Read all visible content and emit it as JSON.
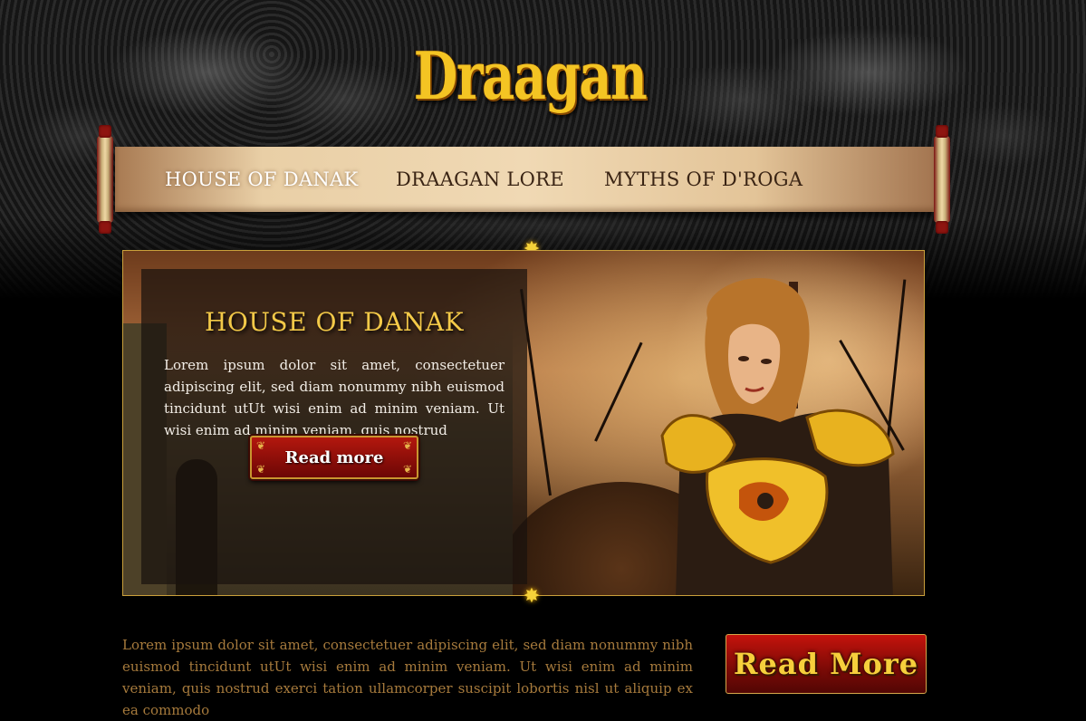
{
  "brand": {
    "logo_text": "Draagan"
  },
  "nav": {
    "items": [
      {
        "label": "HOUSE OF DANAK",
        "active": true
      },
      {
        "label": "DRAAGAN LORE",
        "active": false
      },
      {
        "label": "MYTHS OF D'ROGA",
        "active": false
      }
    ]
  },
  "hero": {
    "title": "HOUSE OF DANAK",
    "text": "Lorem ipsum dolor sit amet, consectetuer adipiscing elit, sed diam nonummy nibh euismod tincidunt utUt wisi enim ad minim veniam. Ut wisi enim ad minim veniam, quis nostrud",
    "button_label": "Read more"
  },
  "intro": {
    "text": "Lorem ipsum dolor sit amet, consectetuer adipiscing elit, sed diam nonummy nibh euismod tincidunt utUt wisi enim ad minim veniam. Ut wisi enim ad minim veniam, quis nostrud exerci tation ullamcorper suscipit lobortis nisl ut aliquip ex ea commodo",
    "button_label": "Read More"
  },
  "colors": {
    "logo_gold": "#f4c423",
    "nav_text": "#3a2414",
    "hero_title": "#f3c948",
    "button_red": "#b3170e",
    "intro_text": "#a67a3c"
  }
}
